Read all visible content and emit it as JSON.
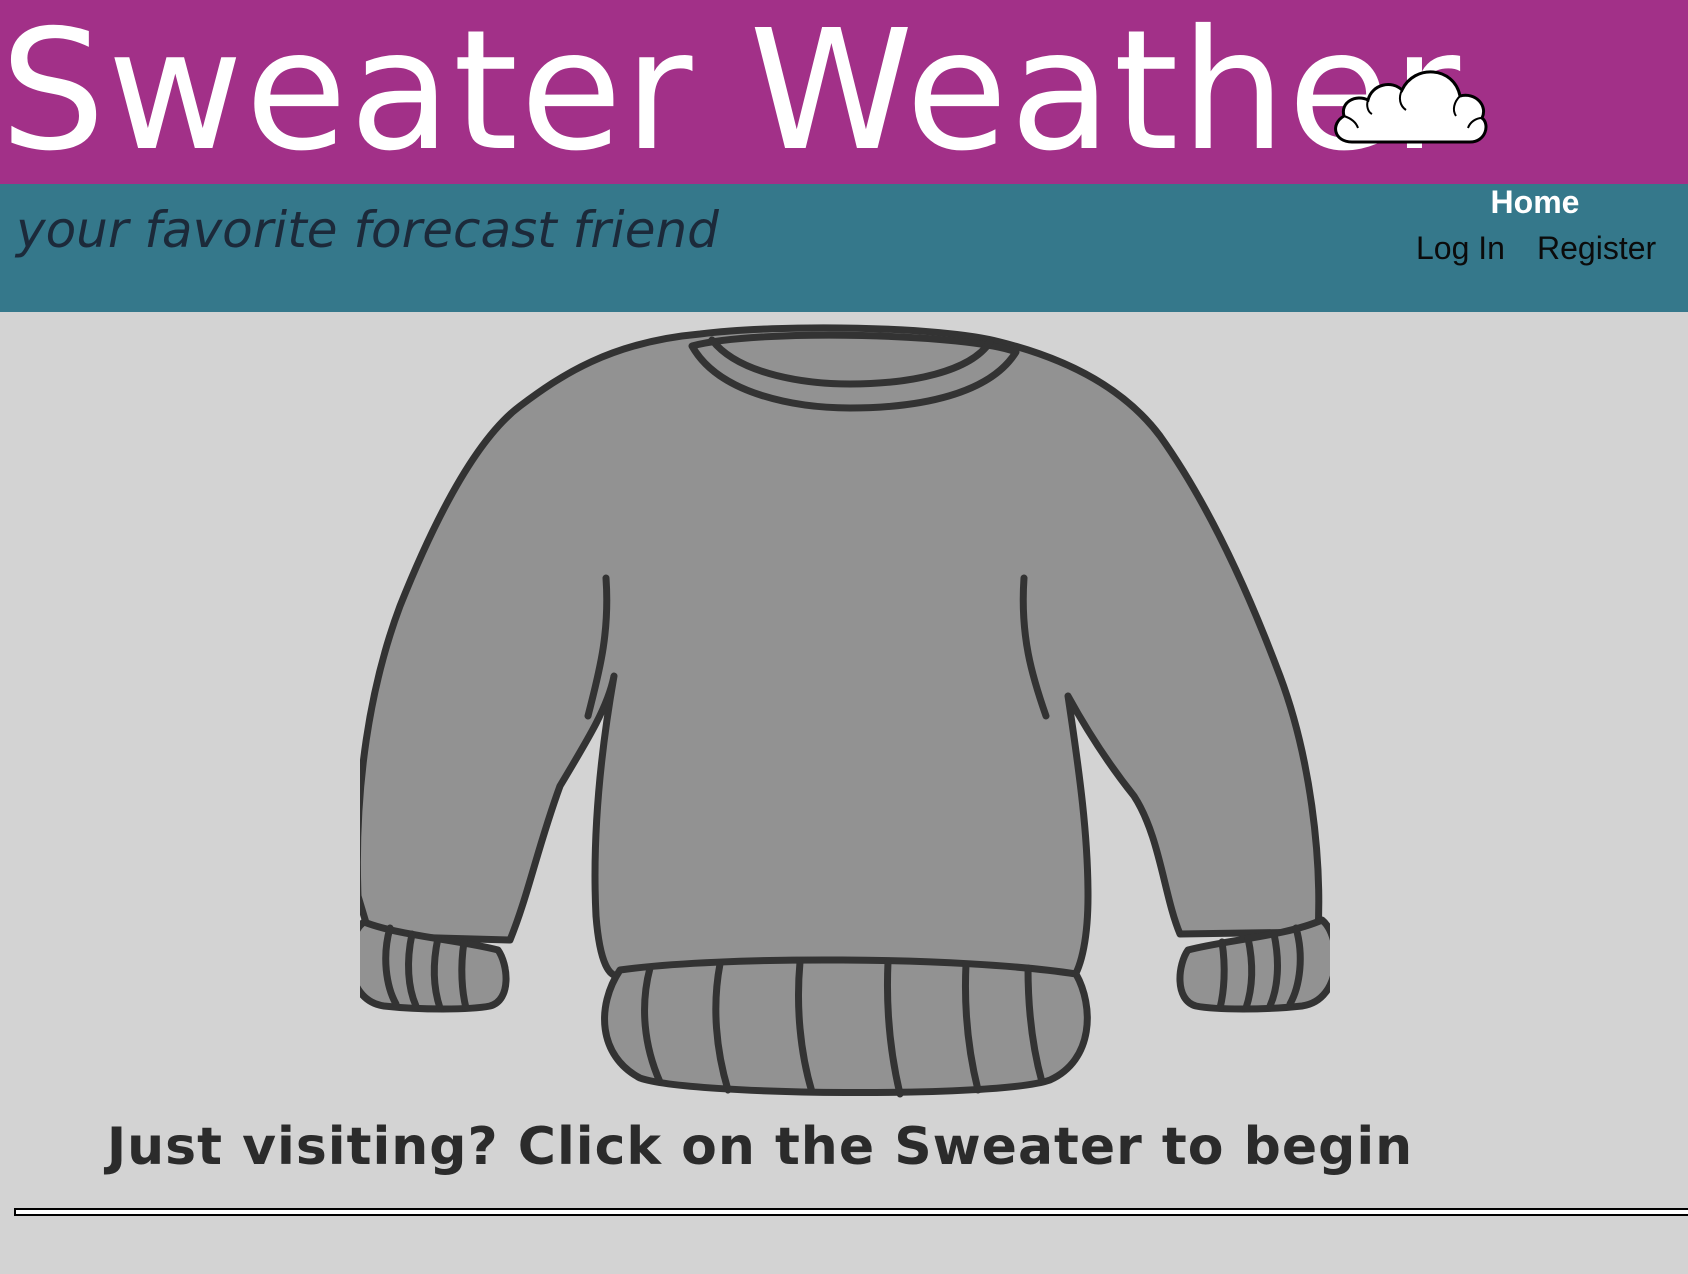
{
  "header": {
    "title": "Sweater Weather",
    "cloud_icon": "cloud-icon",
    "background_color": "#a23088"
  },
  "subheader": {
    "tagline": "your favorite forecast friend",
    "background_color": "#35788b"
  },
  "nav": {
    "home": "Home",
    "login": "Log In",
    "register": "Register"
  },
  "main": {
    "sweater_icon": "sweater-icon",
    "cta_text": "Just visiting? Click on the Sweater to begin",
    "background_color": "#d3d3d3"
  }
}
